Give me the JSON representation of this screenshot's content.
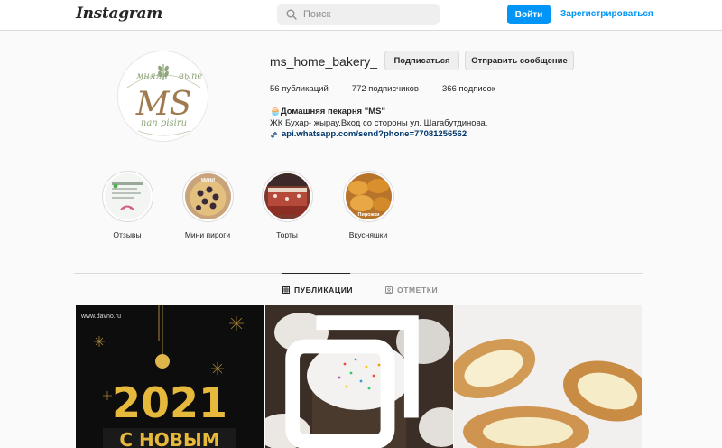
{
  "nav": {
    "logo": "Instagram",
    "search_placeholder": "Поиск",
    "login_label": "Войти",
    "signup_label": "Зарегистрироваться"
  },
  "profile": {
    "username": "ms_home_bakery_",
    "follow_label": "Подписаться",
    "message_label": "Отправить сообщение",
    "avatar_logo": {
      "top_left": "мняяя",
      "top_right": "выпе",
      "monogram": "MS",
      "bottom": "nan pisiru"
    },
    "stats": {
      "posts": "56 публикаций",
      "followers": "772 подписчиков",
      "following": "366 подписок"
    },
    "bio": {
      "name": "🧁Домашняя пекарня \"MS\"",
      "address": "ЖК Бухар- жырау.Вход со стороны ул. Шагабутдинова.",
      "link": "api.whatsapp.com/send?phone=77081256562"
    }
  },
  "highlights": [
    {
      "label": "Отзывы",
      "icon": "reviews-screenshot"
    },
    {
      "label": "Мини пироги",
      "icon": "mini-pie"
    },
    {
      "label": "Торты",
      "icon": "cake"
    },
    {
      "label": "Вкусняшки",
      "icon": "pastries"
    }
  ],
  "highlight_overlays": {
    "mini": "МИНИ",
    "pastries": "Пирожки"
  },
  "tabs": {
    "posts": "ПУБЛИКАЦИИ",
    "tagged": "ОТМЕТКИ"
  },
  "posts": {
    "post1": {
      "watermark": "www.davno.ru",
      "year": "2021",
      "greeting": "С НОВЫМ"
    },
    "post2": {
      "type": "photo",
      "multi": true
    },
    "post3": {
      "type": "photo"
    }
  },
  "colors": {
    "accent": "#0095f6",
    "link": "#00376b",
    "avatar_green": "#8fa67a",
    "avatar_brown": "#a07a4f"
  }
}
